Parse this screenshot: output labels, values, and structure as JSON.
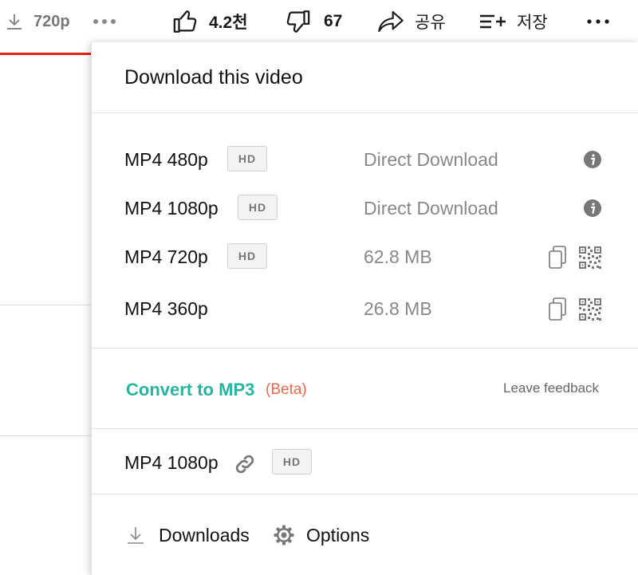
{
  "topbar": {
    "quality": "720p",
    "like_count": "4.2천",
    "dislike_count": "67",
    "share_label": "공유",
    "save_label": "저장"
  },
  "popup": {
    "title": "Download this video",
    "formats": [
      {
        "label": "MP4 480p",
        "hd": "HD",
        "info": "Direct Download",
        "action": "info-icon"
      },
      {
        "label": "MP4 1080p",
        "hd": "HD",
        "info": "Direct Download",
        "action": "info-icon"
      },
      {
        "label": "MP4 720p",
        "hd": "HD",
        "info": "62.8 MB",
        "action": "copy-qr"
      },
      {
        "label": "MP4 360p",
        "hd": "",
        "info": "26.8 MB",
        "action": "copy-qr"
      }
    ],
    "convert_label": "Convert to MP3",
    "beta_label": "(Beta)",
    "feedback_label": "Leave feedback",
    "link_row": {
      "label": "MP4 1080p",
      "hd": "HD"
    },
    "footer": {
      "downloads_label": "Downloads",
      "options_label": "Options"
    }
  },
  "colors": {
    "accent_green": "#28b5a0",
    "beta_orange": "#e86a4c",
    "youtube_red": "#e62117"
  }
}
